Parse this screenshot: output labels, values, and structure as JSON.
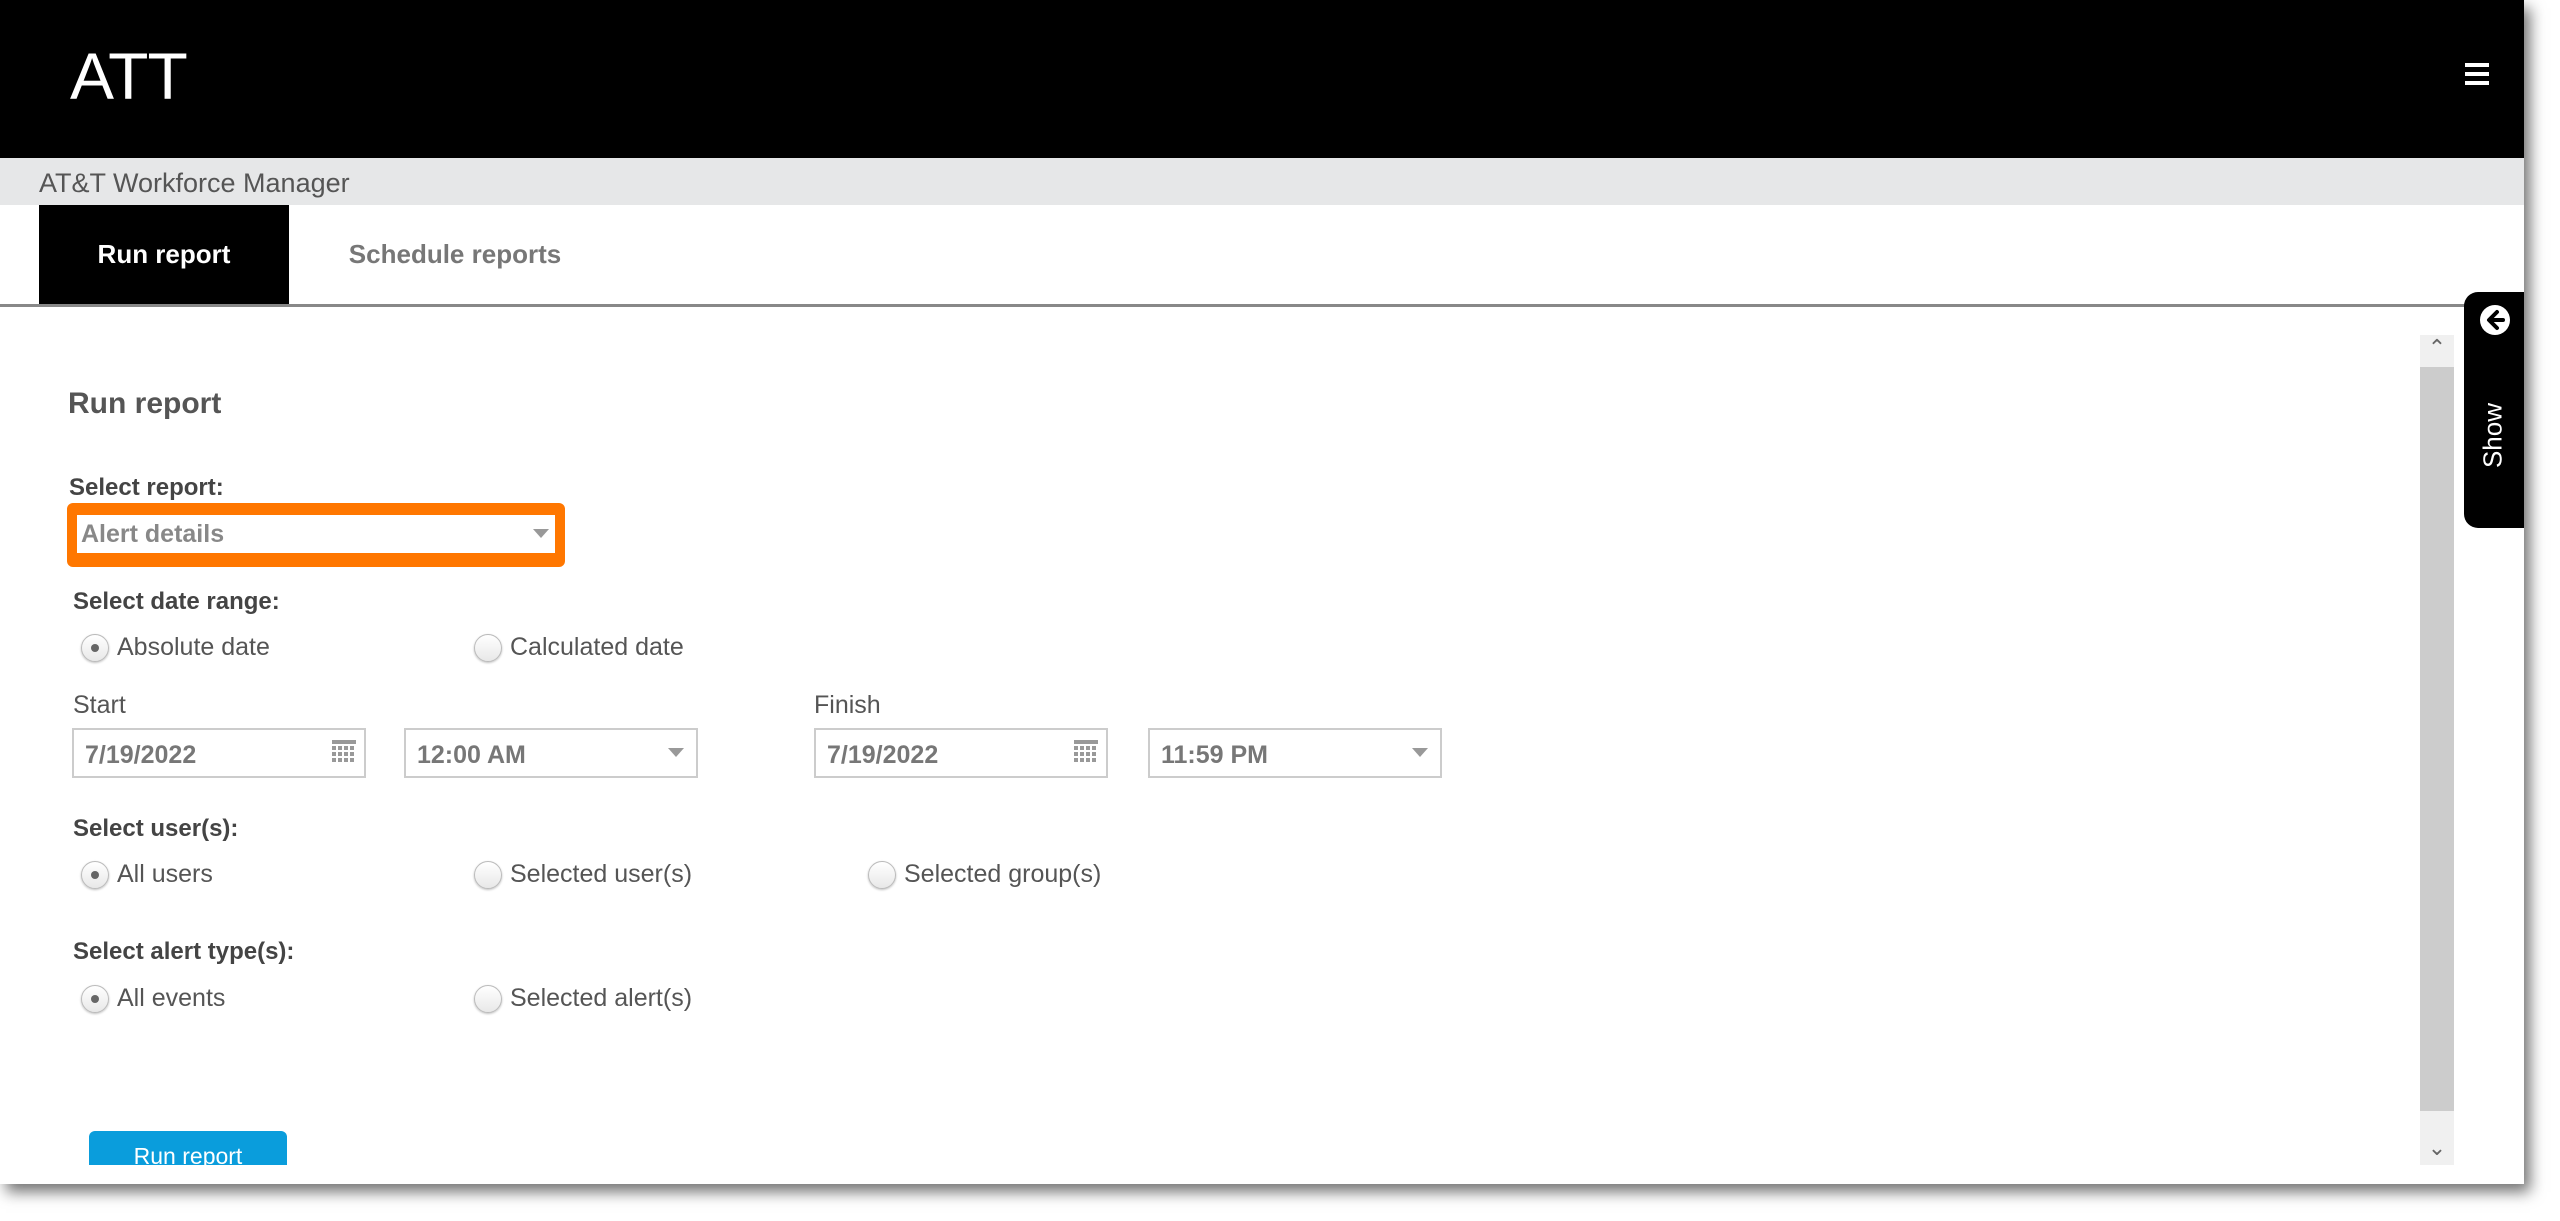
{
  "header": {
    "brand": "ATT",
    "menu_icon": "hamburger-icon"
  },
  "app_title": "AT&T Workforce Manager",
  "tabs": [
    {
      "label": "Run report",
      "active": true
    },
    {
      "label": "Schedule reports",
      "active": false
    }
  ],
  "form": {
    "title": "Run report",
    "select_report": {
      "label": "Select report:",
      "value": "Alert details",
      "highlight_color": "#ff7700"
    },
    "date_range": {
      "label": "Select date range:",
      "options": [
        {
          "label": "Absolute date",
          "checked": true
        },
        {
          "label": "Calculated date",
          "checked": false
        }
      ],
      "start_label": "Start",
      "start_date": "7/19/2022",
      "start_time": "12:00 AM",
      "finish_label": "Finish",
      "finish_date": "7/19/2022",
      "finish_time": "11:59 PM"
    },
    "users": {
      "label": "Select user(s):",
      "options": [
        {
          "label": "All users",
          "checked": true
        },
        {
          "label": "Selected user(s)",
          "checked": false
        },
        {
          "label": "Selected group(s)",
          "checked": false
        }
      ]
    },
    "alert_types": {
      "label": "Select alert type(s):",
      "options": [
        {
          "label": "All events",
          "checked": true
        },
        {
          "label": "Selected alert(s)",
          "checked": false
        }
      ]
    },
    "run_button": "Run report",
    "run_button_color": "#0a9ddc"
  },
  "side_panel": {
    "label": "Show",
    "icon": "arrow-left-circle-icon"
  }
}
